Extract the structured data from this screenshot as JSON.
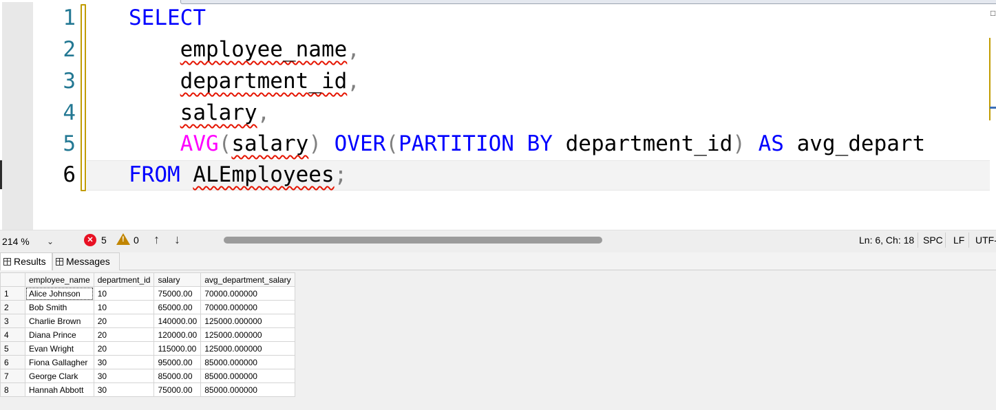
{
  "editor": {
    "line_numbers": [
      "1",
      "2",
      "3",
      "4",
      "5",
      "6"
    ],
    "lines": [
      {
        "tokens": [
          {
            "t": "SELECT",
            "c": "kw"
          }
        ]
      },
      {
        "tokens": [
          {
            "t": "    employee_name",
            "c": "err"
          },
          {
            "t": ",",
            "c": "punct"
          }
        ]
      },
      {
        "tokens": [
          {
            "t": "    department_id",
            "c": "err"
          },
          {
            "t": ",",
            "c": "punct"
          }
        ]
      },
      {
        "tokens": [
          {
            "t": "    salary",
            "c": "err"
          },
          {
            "t": ",",
            "c": "punct"
          }
        ]
      },
      {
        "tokens": [
          {
            "t": "    "
          },
          {
            "t": "AVG",
            "c": "fn"
          },
          {
            "t": "(",
            "c": "punct"
          },
          {
            "t": "salary",
            "c": "err"
          },
          {
            "t": ")",
            "c": "punct"
          },
          {
            "t": " "
          },
          {
            "t": "OVER",
            "c": "kw"
          },
          {
            "t": "(",
            "c": "punct"
          },
          {
            "t": "PARTITION BY",
            "c": "kw"
          },
          {
            "t": " department_id"
          },
          {
            "t": ")",
            "c": "punct"
          },
          {
            "t": " "
          },
          {
            "t": "AS",
            "c": "kw"
          },
          {
            "t": " avg_depart"
          }
        ]
      },
      {
        "tokens": [
          {
            "t": "FROM",
            "c": "kw"
          },
          {
            "t": " "
          },
          {
            "t": "ALEmployees",
            "c": "err"
          },
          {
            "t": ";",
            "c": "punct"
          }
        ]
      }
    ],
    "active_line": 6
  },
  "status": {
    "zoom": "214 %",
    "errors": "5",
    "warnings": "0",
    "up_arrow": "↑",
    "down_arrow": "↓",
    "position": "Ln: 6, Ch: 18",
    "indent": "SPC",
    "eol": "LF",
    "encoding": "UTF-"
  },
  "tabs": {
    "results": "Results",
    "messages": "Messages"
  },
  "results": {
    "columns": [
      "employee_name",
      "department_id",
      "salary",
      "avg_department_salary"
    ],
    "rows": [
      [
        "1",
        "Alice Johnson",
        "10",
        "75000.00",
        "70000.000000"
      ],
      [
        "2",
        "Bob Smith",
        "10",
        "65000.00",
        "70000.000000"
      ],
      [
        "3",
        "Charlie Brown",
        "20",
        "140000.00",
        "125000.000000"
      ],
      [
        "4",
        "Diana Prince",
        "20",
        "120000.00",
        "125000.000000"
      ],
      [
        "5",
        "Evan Wright",
        "20",
        "115000.00",
        "125000.000000"
      ],
      [
        "6",
        "Fiona Gallagher",
        "30",
        "95000.00",
        "85000.000000"
      ],
      [
        "7",
        "George Clark",
        "30",
        "85000.00",
        "85000.000000"
      ],
      [
        "8",
        "Hannah Abbott",
        "30",
        "75000.00",
        "85000.000000"
      ]
    ]
  },
  "colors": {
    "keyword": "#0000ff",
    "function": "#ff00ff",
    "error_squiggle": "#e51400",
    "line_number": "#237893",
    "change_marker": "#c19c00"
  }
}
